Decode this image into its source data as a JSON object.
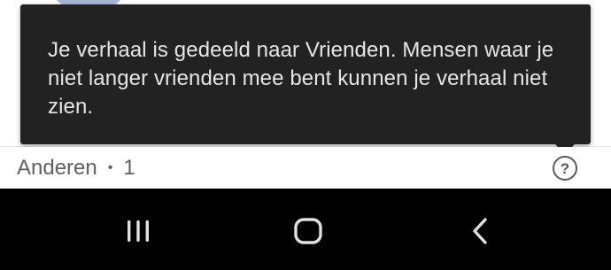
{
  "tooltip": {
    "message": "Je verhaal is gedeeld naar Vrienden. Mensen waar je niet langer vrienden mee bent kunnen je verhaal niet zien."
  },
  "section": {
    "label": "Anderen",
    "separator": "•",
    "count": "1",
    "help_icon": "question-circle-icon",
    "help_glyph": "?"
  },
  "navigation_bar": {
    "recent_apps_icon": "recent-apps-icon",
    "home_icon": "home-icon",
    "back_icon": "back-chevron-icon"
  },
  "colors": {
    "tooltip_background": "#222222",
    "tooltip_text": "#e6e6e6",
    "section_text": "#606060",
    "nav_background": "#000000",
    "nav_icon": "#e0e0e0"
  }
}
